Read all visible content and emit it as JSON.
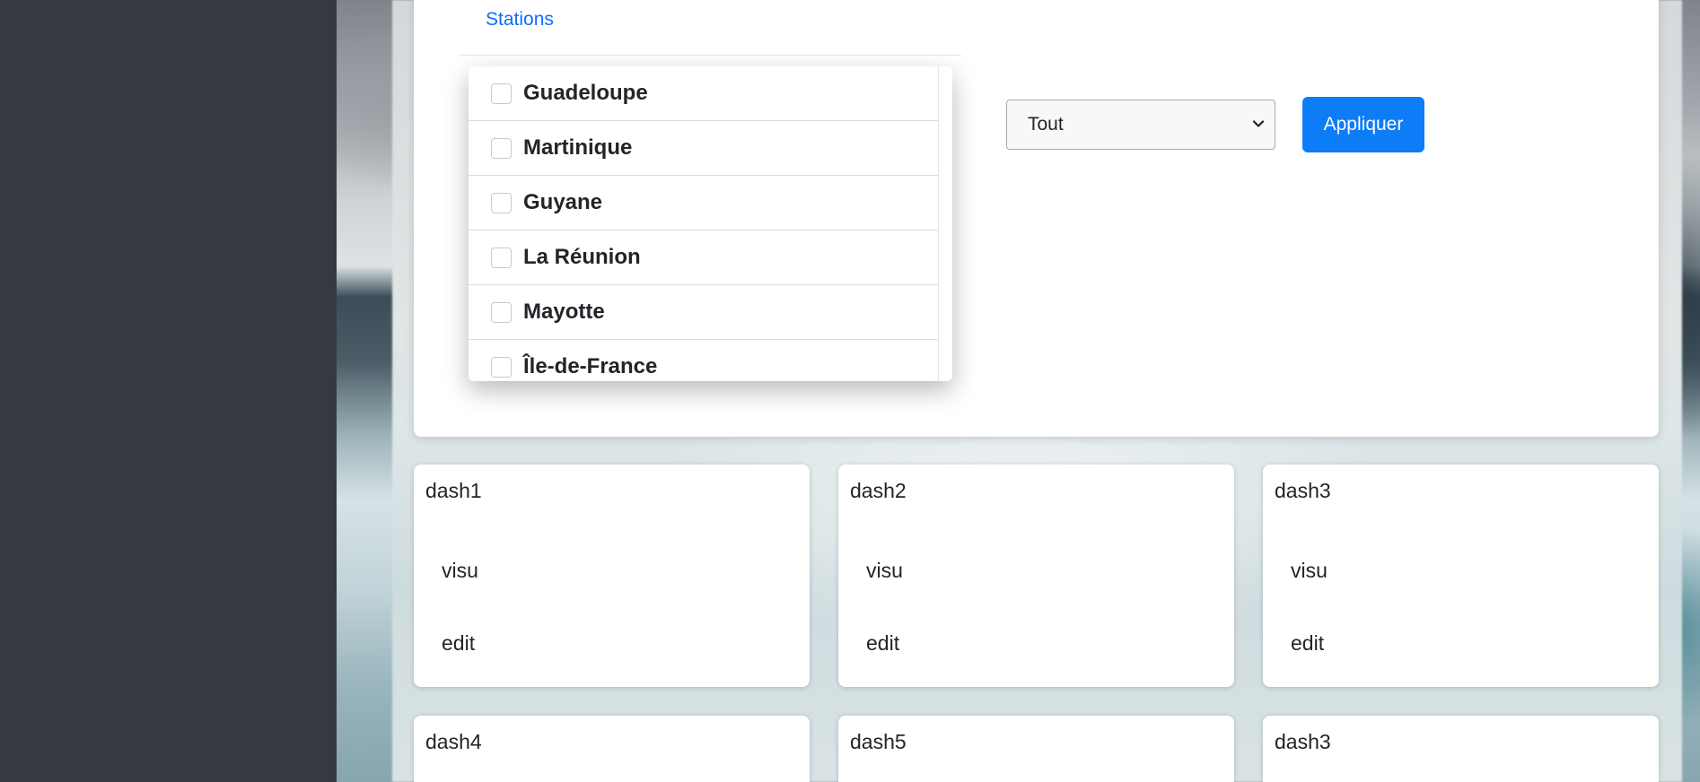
{
  "tabs": {
    "stations_label": "Stations"
  },
  "regions": [
    {
      "label": "Guadeloupe",
      "checked": false
    },
    {
      "label": "Martinique",
      "checked": false
    },
    {
      "label": "Guyane",
      "checked": false
    },
    {
      "label": "La Réunion",
      "checked": false
    },
    {
      "label": "Mayotte",
      "checked": false
    },
    {
      "label": "Île-de-France",
      "checked": false
    }
  ],
  "filter": {
    "select_value": "Tout",
    "apply_label": "Appliquer"
  },
  "dashboards": [
    {
      "title": "dash1",
      "visu_label": "visu",
      "edit_label": "edit"
    },
    {
      "title": "dash2",
      "visu_label": "visu",
      "edit_label": "edit"
    },
    {
      "title": "dash3",
      "visu_label": "visu",
      "edit_label": "edit"
    },
    {
      "title": "dash4"
    },
    {
      "title": "dash5"
    },
    {
      "title": "dash3"
    }
  ],
  "colors": {
    "accent": "#0d7df7",
    "link": "#0d6efd",
    "sidebar": "#343a40"
  }
}
